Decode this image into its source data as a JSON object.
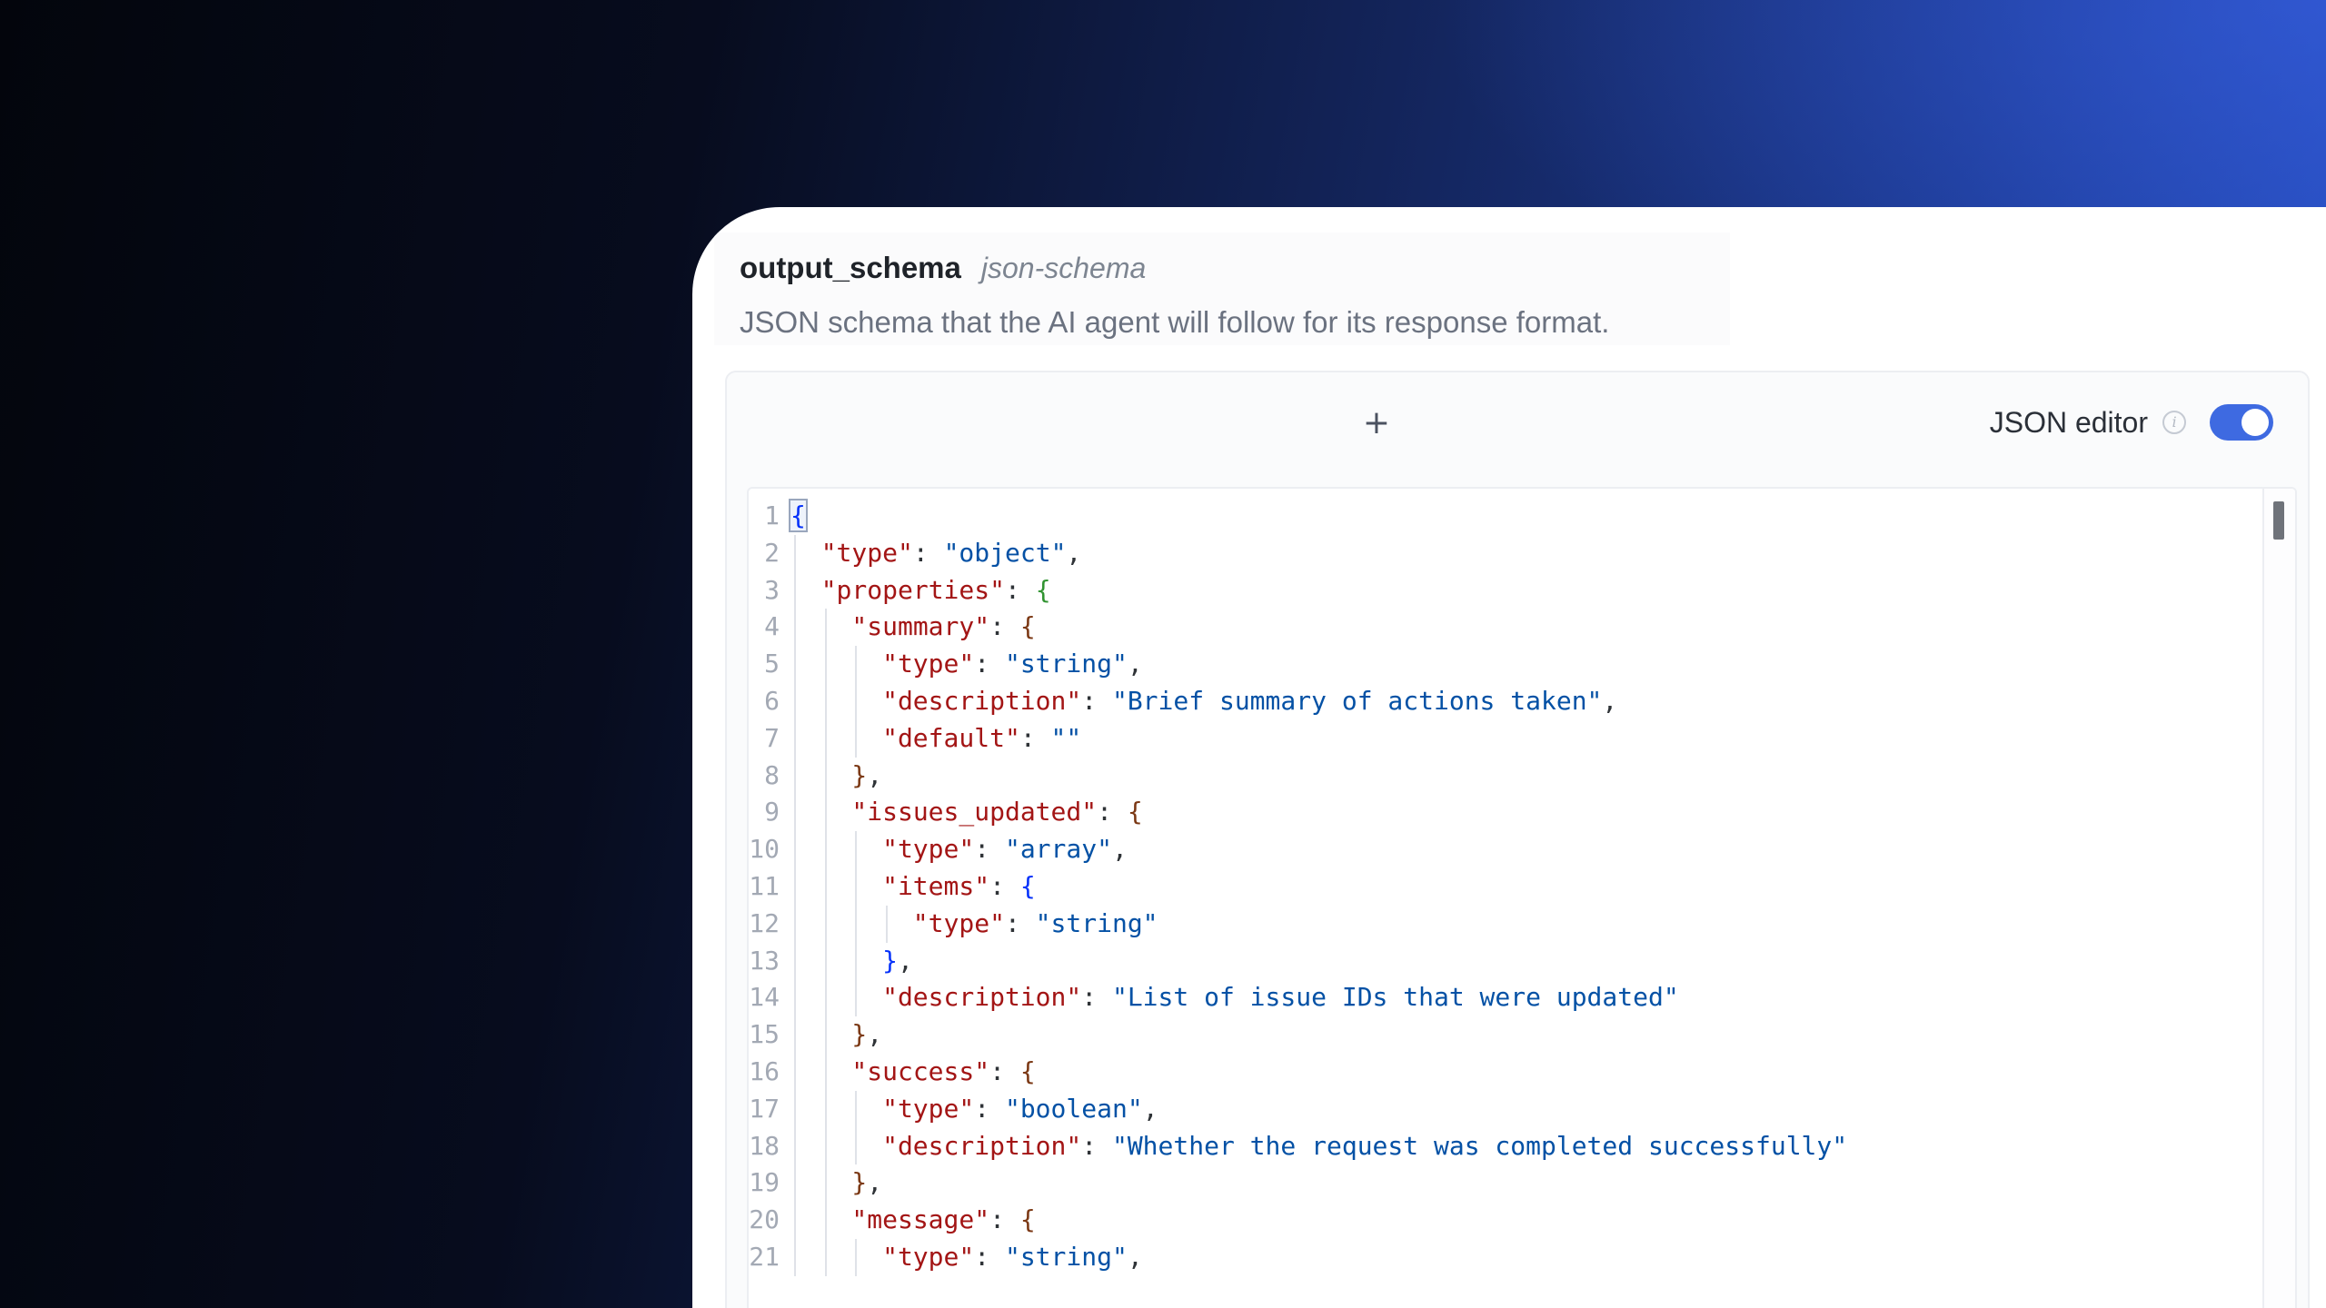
{
  "field": {
    "name": "output_schema",
    "type": "json-schema",
    "description": "JSON schema that the AI agent will follow for its response format."
  },
  "toolbar": {
    "add_label": "+",
    "json_editor_label": "JSON editor",
    "info_icon": "info-icon",
    "json_editor_enabled": true,
    "toggle_color": "#3e6ae1"
  },
  "editor": {
    "lines": [
      {
        "number": "1",
        "indent": 0,
        "tokens": [
          {
            "t": "{",
            "k": "brace-0"
          }
        ]
      },
      {
        "number": "2",
        "indent": 1,
        "tokens": [
          {
            "t": "\"type\"",
            "k": "key"
          },
          {
            "t": ": ",
            "k": "punct"
          },
          {
            "t": "\"object\"",
            "k": "str"
          },
          {
            "t": ",",
            "k": "punct"
          }
        ]
      },
      {
        "number": "3",
        "indent": 1,
        "tokens": [
          {
            "t": "\"properties\"",
            "k": "key"
          },
          {
            "t": ": ",
            "k": "punct"
          },
          {
            "t": "{",
            "k": "brace-1"
          }
        ]
      },
      {
        "number": "4",
        "indent": 2,
        "tokens": [
          {
            "t": "\"summary\"",
            "k": "key"
          },
          {
            "t": ": ",
            "k": "punct"
          },
          {
            "t": "{",
            "k": "brace-2"
          }
        ]
      },
      {
        "number": "5",
        "indent": 3,
        "tokens": [
          {
            "t": "\"type\"",
            "k": "key"
          },
          {
            "t": ": ",
            "k": "punct"
          },
          {
            "t": "\"string\"",
            "k": "str"
          },
          {
            "t": ",",
            "k": "punct"
          }
        ]
      },
      {
        "number": "6",
        "indent": 3,
        "tokens": [
          {
            "t": "\"description\"",
            "k": "key"
          },
          {
            "t": ": ",
            "k": "punct"
          },
          {
            "t": "\"Brief summary of actions taken\"",
            "k": "str"
          },
          {
            "t": ",",
            "k": "punct"
          }
        ]
      },
      {
        "number": "7",
        "indent": 3,
        "tokens": [
          {
            "t": "\"default\"",
            "k": "key"
          },
          {
            "t": ": ",
            "k": "punct"
          },
          {
            "t": "\"\"",
            "k": "str"
          }
        ]
      },
      {
        "number": "8",
        "indent": 2,
        "tokens": [
          {
            "t": "}",
            "k": "brace-2"
          },
          {
            "t": ",",
            "k": "punct"
          }
        ]
      },
      {
        "number": "9",
        "indent": 2,
        "tokens": [
          {
            "t": "\"issues_updated\"",
            "k": "key"
          },
          {
            "t": ": ",
            "k": "punct"
          },
          {
            "t": "{",
            "k": "brace-2"
          }
        ]
      },
      {
        "number": "10",
        "indent": 3,
        "tokens": [
          {
            "t": "\"type\"",
            "k": "key"
          },
          {
            "t": ": ",
            "k": "punct"
          },
          {
            "t": "\"array\"",
            "k": "str"
          },
          {
            "t": ",",
            "k": "punct"
          }
        ]
      },
      {
        "number": "11",
        "indent": 3,
        "tokens": [
          {
            "t": "\"items\"",
            "k": "key"
          },
          {
            "t": ": ",
            "k": "punct"
          },
          {
            "t": "{",
            "k": "brace-0"
          }
        ]
      },
      {
        "number": "12",
        "indent": 4,
        "tokens": [
          {
            "t": "\"type\"",
            "k": "key"
          },
          {
            "t": ": ",
            "k": "punct"
          },
          {
            "t": "\"string\"",
            "k": "str"
          }
        ]
      },
      {
        "number": "13",
        "indent": 3,
        "tokens": [
          {
            "t": "}",
            "k": "brace-0"
          },
          {
            "t": ",",
            "k": "punct"
          }
        ]
      },
      {
        "number": "14",
        "indent": 3,
        "tokens": [
          {
            "t": "\"description\"",
            "k": "key"
          },
          {
            "t": ": ",
            "k": "punct"
          },
          {
            "t": "\"List of issue IDs that were updated\"",
            "k": "str"
          }
        ]
      },
      {
        "number": "15",
        "indent": 2,
        "tokens": [
          {
            "t": "}",
            "k": "brace-2"
          },
          {
            "t": ",",
            "k": "punct"
          }
        ]
      },
      {
        "number": "16",
        "indent": 2,
        "tokens": [
          {
            "t": "\"success\"",
            "k": "key"
          },
          {
            "t": ": ",
            "k": "punct"
          },
          {
            "t": "{",
            "k": "brace-2"
          }
        ]
      },
      {
        "number": "17",
        "indent": 3,
        "tokens": [
          {
            "t": "\"type\"",
            "k": "key"
          },
          {
            "t": ": ",
            "k": "punct"
          },
          {
            "t": "\"boolean\"",
            "k": "str"
          },
          {
            "t": ",",
            "k": "punct"
          }
        ]
      },
      {
        "number": "18",
        "indent": 3,
        "tokens": [
          {
            "t": "\"description\"",
            "k": "key"
          },
          {
            "t": ": ",
            "k": "punct"
          },
          {
            "t": "\"Whether the request was completed successfully\"",
            "k": "str"
          }
        ]
      },
      {
        "number": "19",
        "indent": 2,
        "tokens": [
          {
            "t": "}",
            "k": "brace-2"
          },
          {
            "t": ",",
            "k": "punct"
          }
        ]
      },
      {
        "number": "20",
        "indent": 2,
        "tokens": [
          {
            "t": "\"message\"",
            "k": "key"
          },
          {
            "t": ": ",
            "k": "punct"
          },
          {
            "t": "{",
            "k": "brace-2"
          }
        ]
      },
      {
        "number": "21",
        "indent": 3,
        "tokens": [
          {
            "t": "\"type\"",
            "k": "key"
          },
          {
            "t": ": ",
            "k": "punct"
          },
          {
            "t": "\"string\"",
            "k": "str"
          },
          {
            "t": ",",
            "k": "punct"
          }
        ]
      }
    ]
  }
}
